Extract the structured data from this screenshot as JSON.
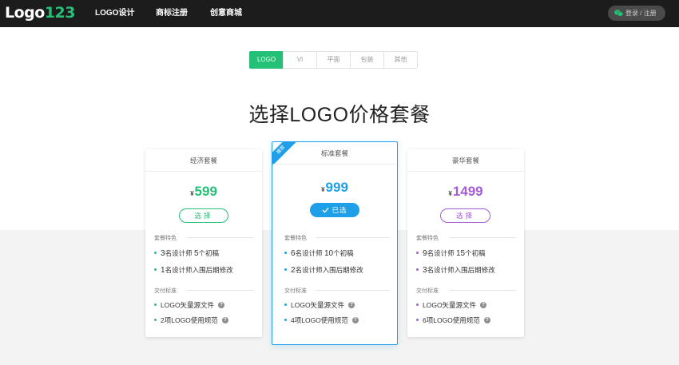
{
  "header": {
    "logo_white": "Logo",
    "logo_green": "123",
    "nav": [
      "LOGO设计",
      "商标注册",
      "创意商城"
    ],
    "login_label": "登录 / 注册"
  },
  "tabs": [
    {
      "label": "LOGO",
      "active": true
    },
    {
      "label": "VI",
      "active": false
    },
    {
      "label": "平面",
      "active": false
    },
    {
      "label": "包装",
      "active": false
    },
    {
      "label": "其他",
      "active": false
    }
  ],
  "page_title": "选择LOGO价格套餐",
  "colors": {
    "green": "#24c077",
    "blue": "#1e9fe8",
    "purple": "#a25cd6"
  },
  "plans": [
    {
      "name": "经济套餐",
      "currency": "¥",
      "price": "599",
      "button_label": "选择",
      "features_label": "套餐特色",
      "features": [
        {
          "num1": "3",
          "t1": "名设计师 ",
          "num2": "5",
          "t2": "个初稿"
        },
        {
          "num1": "1",
          "t1": "名设计师入围后期修改",
          "num2": "",
          "t2": ""
        }
      ],
      "delivery_label": "交付标准",
      "delivery": [
        {
          "text": "LOGO矢量源文件"
        },
        {
          "text": "2项LOGO使用规范"
        }
      ]
    },
    {
      "name": "标准套餐",
      "ribbon": "推荐",
      "currency": "¥",
      "price": "999",
      "button_label": "已选",
      "features_label": "套餐特色",
      "features": [
        {
          "num1": "6",
          "t1": "名设计师 ",
          "num2": "10",
          "t2": "个初稿"
        },
        {
          "num1": "2",
          "t1": "名设计师入围后期修改",
          "num2": "",
          "t2": ""
        }
      ],
      "delivery_label": "交付标准",
      "delivery": [
        {
          "text": "LOGO矢量源文件"
        },
        {
          "text": "4项LOGO使用规范"
        }
      ]
    },
    {
      "name": "豪华套餐",
      "currency": "¥",
      "price": "1499",
      "button_label": "选择",
      "features_label": "套餐特色",
      "features": [
        {
          "num1": "9",
          "t1": "名设计师 ",
          "num2": "15",
          "t2": "个初稿"
        },
        {
          "num1": "3",
          "t1": "名设计师入围后期修改",
          "num2": "",
          "t2": ""
        }
      ],
      "delivery_label": "交付标准",
      "delivery": [
        {
          "text": "LOGO矢量源文件"
        },
        {
          "text": "6项LOGO使用规范"
        }
      ]
    }
  ],
  "help_icon_glyph": "?"
}
